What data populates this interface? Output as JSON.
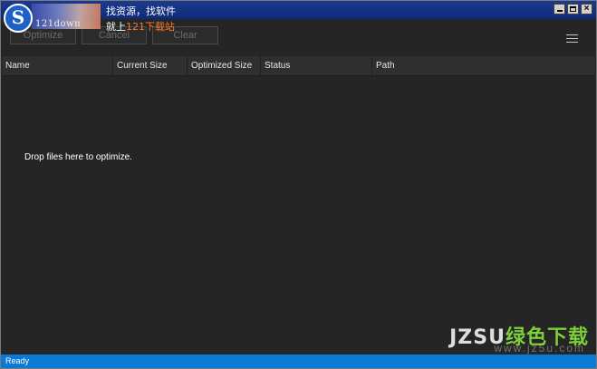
{
  "window": {
    "title": "找资源，找软件",
    "controls": [
      "minimize",
      "maximize",
      "close"
    ]
  },
  "watermark": {
    "logo_letter": "S",
    "domain": "121down",
    "promo_prefix": "就上",
    "promo_accent": "121下载站",
    "bottom_left": "JZSU",
    "bottom_right": "绿色下载",
    "bottom_sub": "www.jz5u.com"
  },
  "toolbar": {
    "optimize_label": "Optimize",
    "cancel_label": "Cancel",
    "clear_label": "Clear",
    "menu_icon": "hamburger-icon"
  },
  "table": {
    "columns": [
      "Name",
      "Current Size",
      "Optimized Size",
      "Status",
      "Path"
    ],
    "empty_message": "Drop files here to optimize."
  },
  "status": {
    "text": "Ready"
  },
  "colors": {
    "background": "#252525",
    "titlebar": "#0f2a79",
    "statusbar": "#0a7ad6"
  }
}
